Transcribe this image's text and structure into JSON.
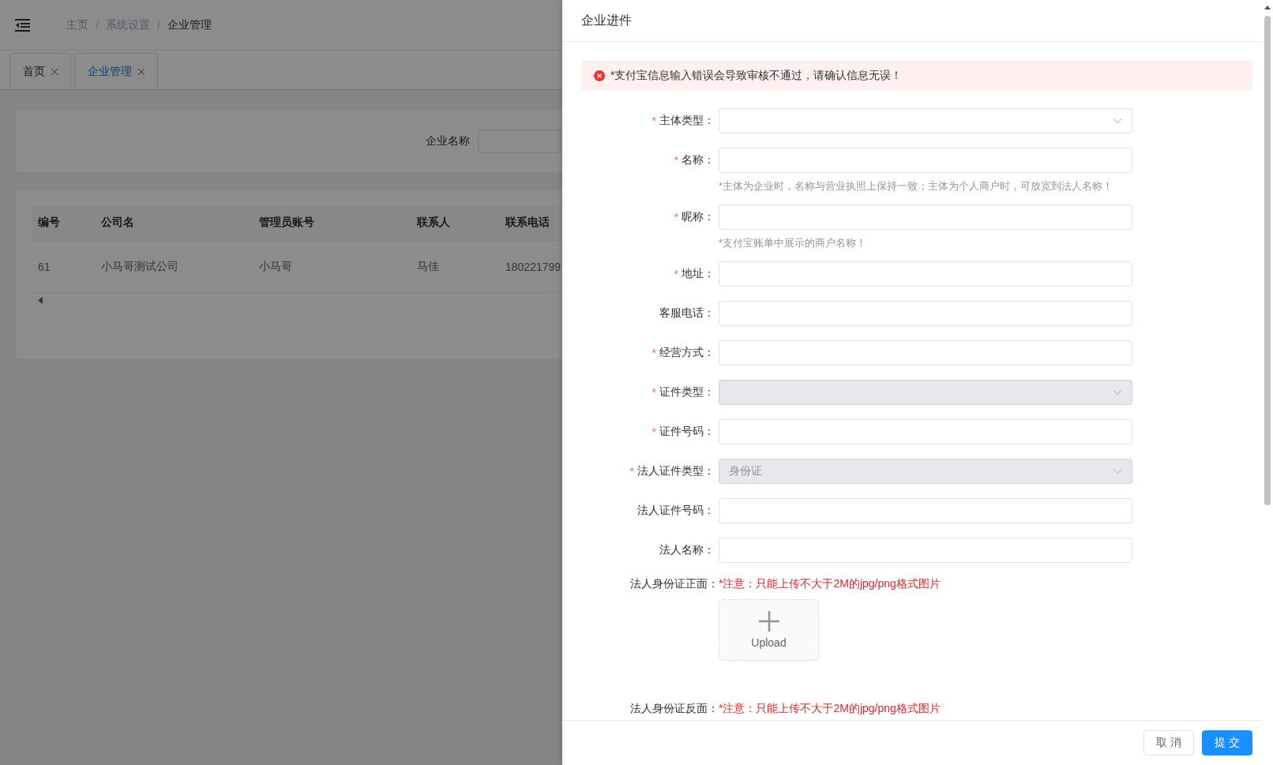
{
  "header": {
    "breadcrumb": [
      {
        "label": "主页",
        "current": false
      },
      {
        "label": "系统设置",
        "current": false
      },
      {
        "label": "企业管理",
        "current": true
      }
    ],
    "separators": [
      "/",
      "/"
    ]
  },
  "tabs": [
    {
      "label": "首页",
      "selected": false
    },
    {
      "label": "企业管理",
      "selected": true
    }
  ],
  "search": {
    "label": "企业名称"
  },
  "table": {
    "columns": [
      "编号",
      "公司名",
      "管理员账号",
      "联系人",
      "联系电话"
    ],
    "rows": [
      [
        "61",
        "小马哥测试公司",
        "小马哥",
        "马佳",
        "180221799"
      ]
    ]
  },
  "drawer": {
    "title": "企业进件",
    "alert": {
      "kind": "error",
      "text": "*支付宝信息输入错误会导致审核不通过，请确认信息无误！"
    },
    "fields": [
      {
        "label": "主体类型：",
        "mark": "*",
        "kind": "select",
        "disabled": false
      },
      {
        "label": "名称：",
        "mark": "*",
        "kind": "input",
        "disabled": false,
        "hint": "*主体为企业时，名称与营业执照上保持一致；主体为个人商户时，可放宽到法人名称！"
      },
      {
        "label": "昵称：",
        "mark": "*",
        "kind": "input",
        "disabled": false,
        "hint": "*支付宝账单中展示的商户名称！"
      },
      {
        "label": "地址：",
        "mark": "*",
        "kind": "input",
        "disabled": false
      },
      {
        "label": "客服电话：",
        "kind": "input",
        "disabled": false
      },
      {
        "label": "经营方式：",
        "mark": "*",
        "kind": "input",
        "disabled": false
      },
      {
        "label": "证件类型：",
        "mark": "*",
        "kind": "select",
        "disabled": true
      },
      {
        "label": "证件号码：",
        "mark": "*",
        "kind": "input",
        "disabled": false
      },
      {
        "label": "法人证件类型：",
        "mark": "*",
        "kind": "select",
        "disabled": true,
        "value": "身份证"
      },
      {
        "label": "法人证件号码：",
        "kind": "input",
        "disabled": false
      },
      {
        "label": "法人名称：",
        "kind": "input",
        "disabled": false
      }
    ],
    "uploads": [
      {
        "label": "法人身份证正面：",
        "note": "*注意：只能上传不大于2M的jpg/png格式图片",
        "button": "Upload"
      },
      {
        "label": "法人身份证反面：",
        "note": "*注意：只能上传不大于2M的jpg/png格式图片"
      }
    ],
    "buttons": [
      {
        "label": "取 消",
        "kind": "default"
      },
      {
        "label": "提 交",
        "kind": "primary"
      }
    ]
  }
}
